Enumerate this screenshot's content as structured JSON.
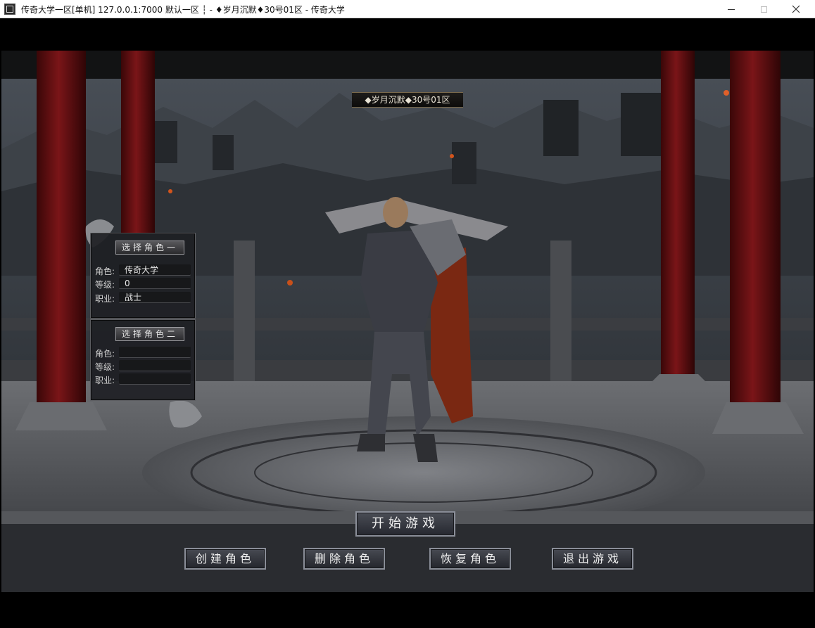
{
  "window": {
    "title": "传奇大学一区[单机] 127.0.0.1:7000  默认一区 ┆ - ♦岁月沉默♦30号01区 - 传奇大学",
    "controls": [
      "minimize",
      "maximize",
      "close"
    ]
  },
  "server_banner": "◆岁月沉默◆30号01区",
  "slots": [
    {
      "button": "选择角色一",
      "fields": [
        {
          "label": "角色:",
          "value": "传奇大学"
        },
        {
          "label": "等级:",
          "value": "0"
        },
        {
          "label": "职业:",
          "value": "战士"
        }
      ]
    },
    {
      "button": "选择角色二",
      "fields": [
        {
          "label": "角色:",
          "value": ""
        },
        {
          "label": "等级:",
          "value": ""
        },
        {
          "label": "职业:",
          "value": ""
        }
      ]
    }
  ],
  "actions": {
    "start": "开始游戏",
    "create": "创建角色",
    "delete": "删除角色",
    "restore": "恢复角色",
    "exit": "退出游戏"
  },
  "colors": {
    "pillar": "#5a0d10",
    "button_border": "#8a8e98",
    "panel_bg": "#1e2024",
    "banner_gold": "#7b6a4c"
  },
  "icons": [
    "app-icon",
    "dragon-ornament-icon",
    "warrior-character"
  ]
}
